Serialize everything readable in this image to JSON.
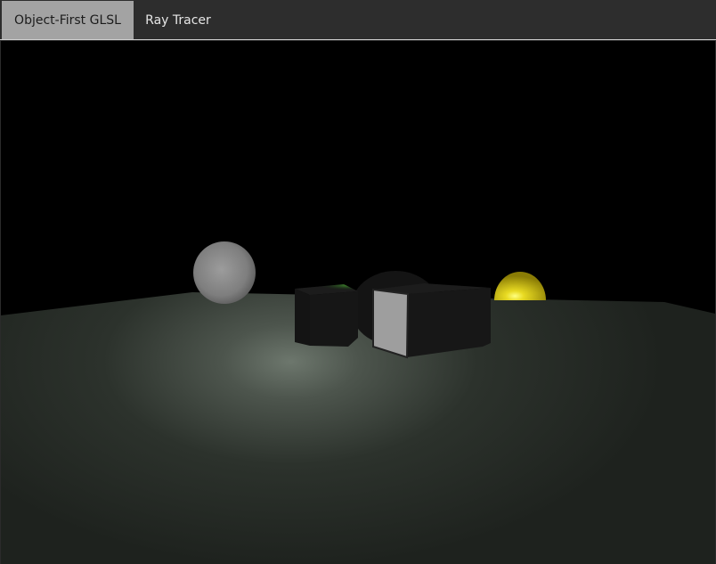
{
  "tabs": [
    {
      "label": "Object-First GLSL",
      "active": true
    },
    {
      "label": "Ray Tracer",
      "active": false
    }
  ],
  "colors": {
    "tab_active_bg": "#a3a3a3",
    "tabbar_bg": "#2d2d2d",
    "viewport_bg": "#000000",
    "floor": "#333833",
    "yellow_sphere": "#d8c81a",
    "white_cube_face": "#9a9a9a"
  }
}
